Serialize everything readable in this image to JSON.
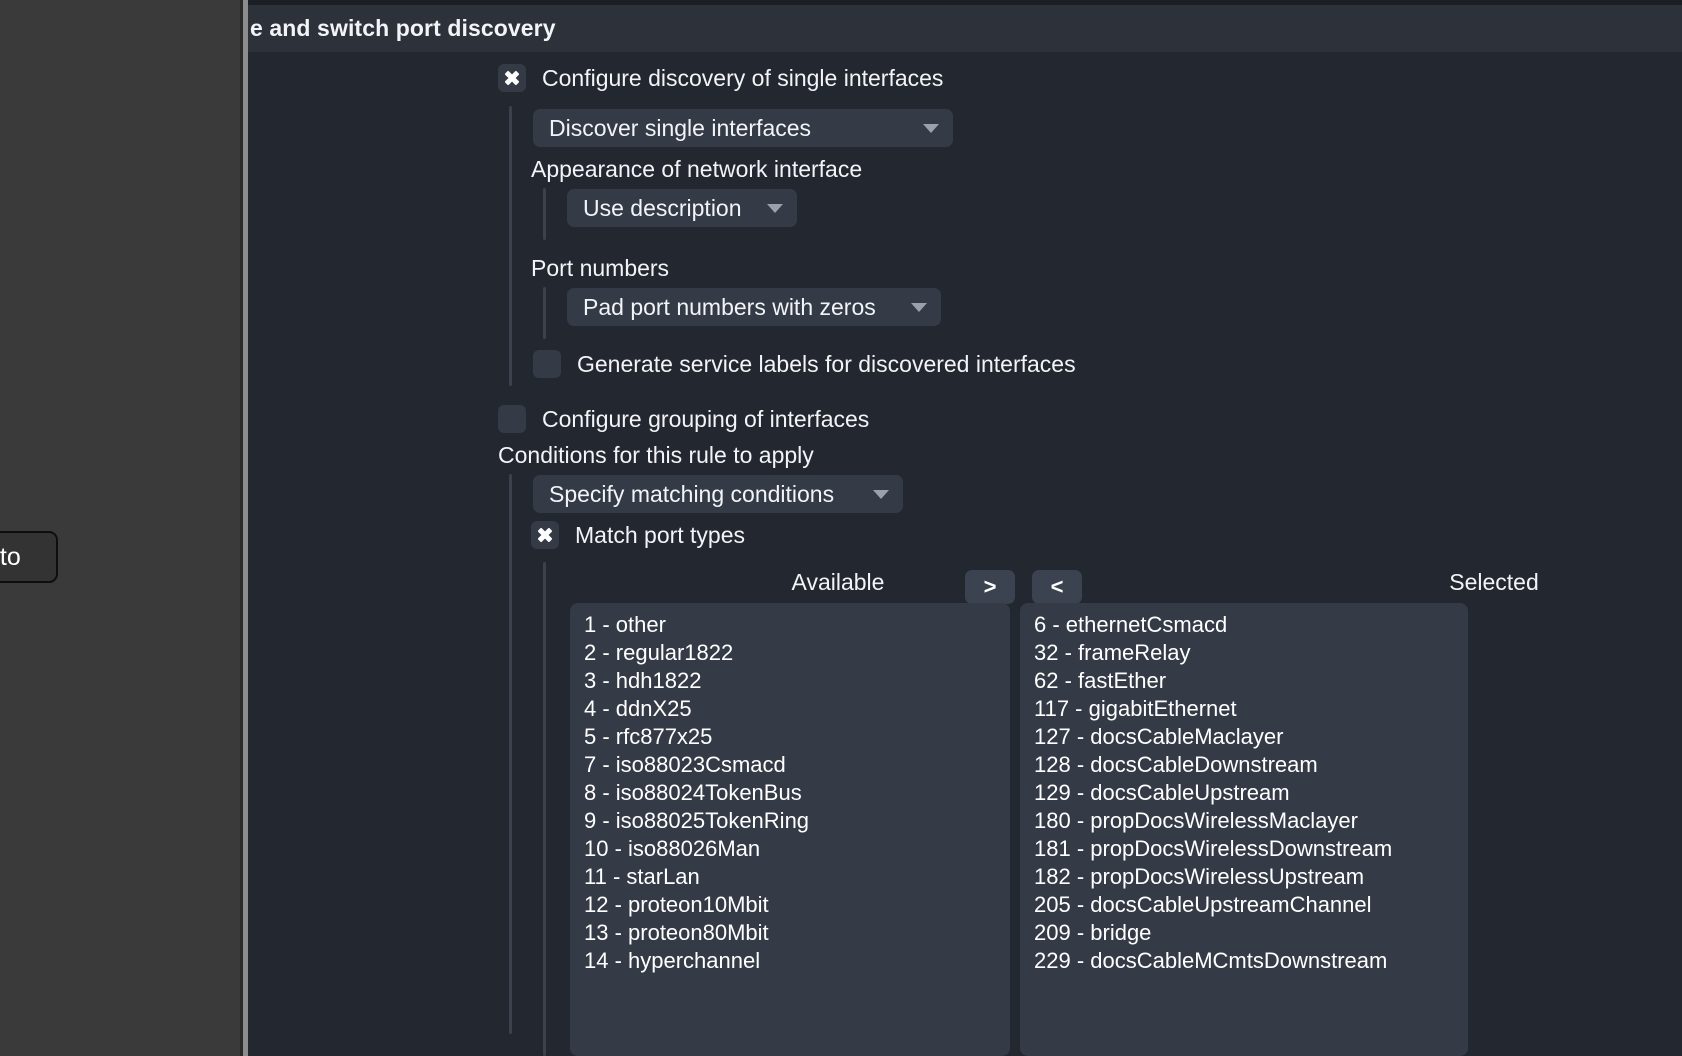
{
  "window": {
    "header_title": "e and switch port discovery"
  },
  "floating_chip": {
    "label": "oto"
  },
  "form": {
    "configure_single": {
      "label": "Configure discovery of single interfaces",
      "checked": true
    },
    "discover_mode": {
      "value": "Discover single interfaces"
    },
    "appearance_label": "Appearance of network interface",
    "appearance_mode": {
      "value": "Use description"
    },
    "port_numbers_label": "Port numbers",
    "port_numbers_mode": {
      "value": "Pad port numbers with zeros"
    },
    "generate_service_labels": {
      "label": "Generate service labels for discovered interfaces",
      "checked": false
    },
    "configure_grouping": {
      "label": "Configure grouping of interfaces",
      "checked": false
    },
    "conditions_label": "Conditions for this rule to apply",
    "conditions_mode": {
      "value": "Specify matching conditions"
    },
    "match_port_types": {
      "label": "Match port types",
      "checked": true
    }
  },
  "dual_list": {
    "available_header": "Available",
    "selected_header": "Selected",
    "move_right_label": ">",
    "move_left_label": "<",
    "available": [
      "1 - other",
      "2 - regular1822",
      "3 - hdh1822",
      "4 - ddnX25",
      "5 - rfc877x25",
      "7 - iso88023Csmacd",
      "8 - iso88024TokenBus",
      "9 - iso88025TokenRing",
      "10 - iso88026Man",
      "11 - starLan",
      "12 - proteon10Mbit",
      "13 - proteon80Mbit",
      "14 - hyperchannel"
    ],
    "selected": [
      "6 - ethernetCsmacd",
      "32 - frameRelay",
      "62 - fastEther",
      "117 - gigabitEthernet",
      "127 - docsCableMaclayer",
      "128 - docsCableDownstream",
      "129 - docsCableUpstream",
      "180 - propDocsWirelessMaclayer",
      "181 - propDocsWirelessDownstream",
      "182 - propDocsWirelessUpstream",
      "205 - docsCableUpstreamChannel",
      "209 - bridge",
      "229 - docsCableMCmtsDownstream"
    ]
  },
  "colors": {
    "panel_bg": "#23272f",
    "header_bg": "#2c313a",
    "control_bg": "#343a46",
    "button_bg": "#3b4250",
    "text": "#f2f4f7",
    "outer_bg": "#3a3a3a"
  }
}
